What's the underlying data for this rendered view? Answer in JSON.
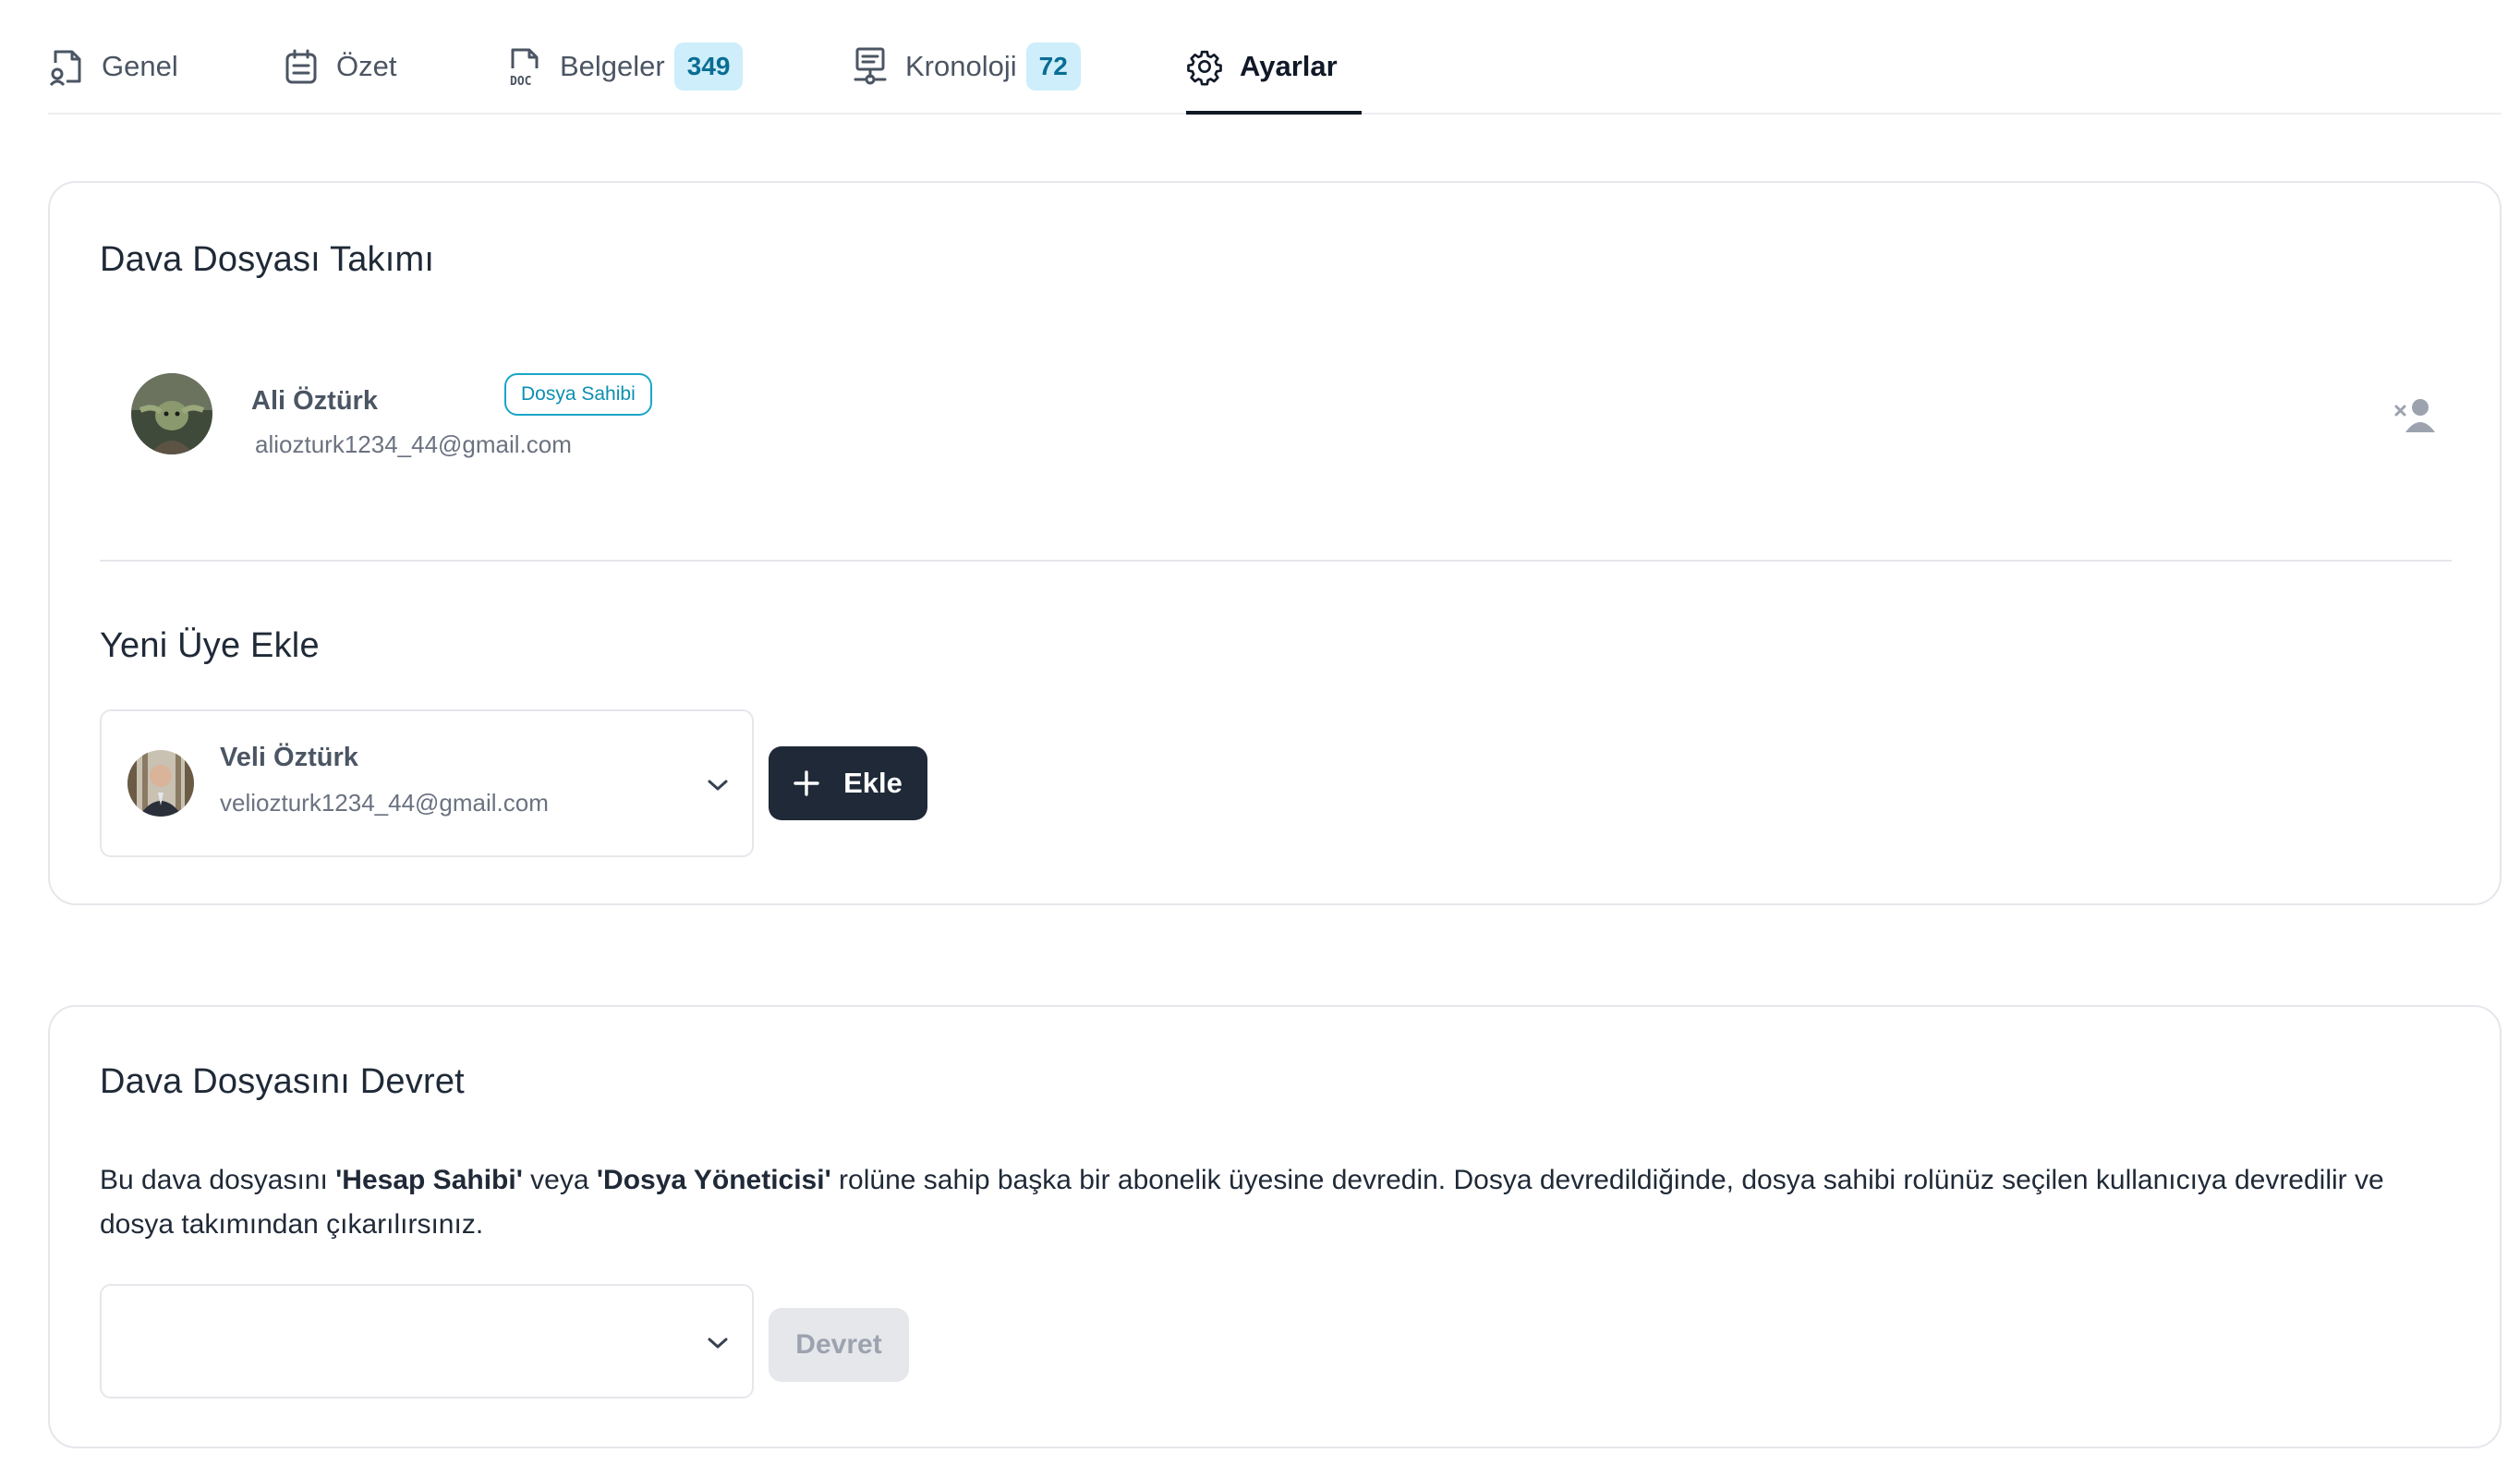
{
  "tabs": [
    {
      "label": "Genel",
      "icon": "person-document-icon"
    },
    {
      "label": "Özet",
      "icon": "calendar-list-icon"
    },
    {
      "label": "Belgeler",
      "icon": "doc-file-icon",
      "badge": "349"
    },
    {
      "label": "Kronoloji",
      "icon": "timeline-monitor-icon",
      "badge": "72"
    },
    {
      "label": "Ayarlar",
      "icon": "gear-icon",
      "active": true
    }
  ],
  "team": {
    "title": "Dava Dosyası Takımı",
    "member": {
      "name": "Ali Öztürk",
      "role": "Dosya Sahibi",
      "email": "aliozturk1234_44@gmail.com",
      "remove_icon": "remove-user-icon"
    }
  },
  "add_member": {
    "title": "Yeni Üye Ekle",
    "selected": {
      "name": "Veli Öztürk",
      "email": "veliozturk1234_44@gmail.com"
    },
    "button_label": "Ekle"
  },
  "transfer": {
    "title": "Dava Dosyasını Devret",
    "description": {
      "part1": "Bu dava dosyasını ",
      "bold1": "'Hesap Sahibi'",
      "part2": " veya ",
      "bold2": "'Dosya Yöneticisi'",
      "part3": " rolüne sahip başka bir abonelik üyesine devredin. Dosya devredildiğinde, dosya sahibi rolünüz seçilen kullanıcıya devredilir ve dosya takımından çıkarılırsınız."
    },
    "select_value": "",
    "button_label": "Devret"
  },
  "colors": {
    "accent": "#1f2937",
    "badge_bg": "#cdeefa",
    "badge_text": "#0a6d94",
    "owner_badge": "#1aa6c8"
  }
}
